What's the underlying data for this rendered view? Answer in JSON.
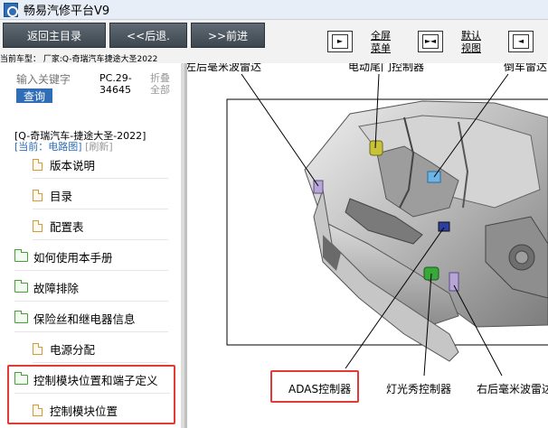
{
  "window": {
    "title": "畅易汽修平台V9"
  },
  "toolbar": {
    "back_main": "返回主目录",
    "back": "<<后退.",
    "forward": ">>前进",
    "fullscreen_menu": [
      "全屏",
      "菜单"
    ],
    "default_view": [
      "默认",
      "视图"
    ],
    "vehicle_line": "当前车型： 厂家:Q-奇瑞汽车捷途大圣2022"
  },
  "sidebar": {
    "search_placeholder": "输入关键字",
    "query_label": "查询",
    "pc_code": "PC.29-34645",
    "fold_all": "折叠全部",
    "model_title": "[Q-奇瑞汽车-捷途大圣-2022]",
    "current_label": "[当前：电路图]",
    "refresh_label": "[刷新]",
    "items": [
      {
        "label": "版本说明",
        "type": "doc"
      },
      {
        "label": "目录",
        "type": "doc"
      },
      {
        "label": "配置表",
        "type": "doc"
      },
      {
        "label": "如何使用本手册",
        "type": "folder"
      },
      {
        "label": "故障排除",
        "type": "folder"
      },
      {
        "label": "保险丝和继电器信息",
        "type": "folder"
      },
      {
        "label": "电源分配",
        "type": "doc"
      },
      {
        "label": "控制模块位置和端子定义",
        "type": "folder"
      },
      {
        "label": "控制模块位置",
        "type": "doc"
      }
    ]
  },
  "diagram": {
    "labels": {
      "rear_radar_left": "左后毫米波雷达",
      "tailgate_ctrl": "电动尾门控制器",
      "reverse_radar": "倒车雷达",
      "adas": "ADAS控制器",
      "light_show": "灯光秀控制器",
      "rear_radar_right": "右后毫米波雷达"
    }
  },
  "colors": {
    "nav_button": "#4a545d",
    "accent_blue": "#2f6db6",
    "highlight_red": "#e53935",
    "folder_green": "#4a9d3a",
    "doc_orange": "#d39a3a"
  }
}
